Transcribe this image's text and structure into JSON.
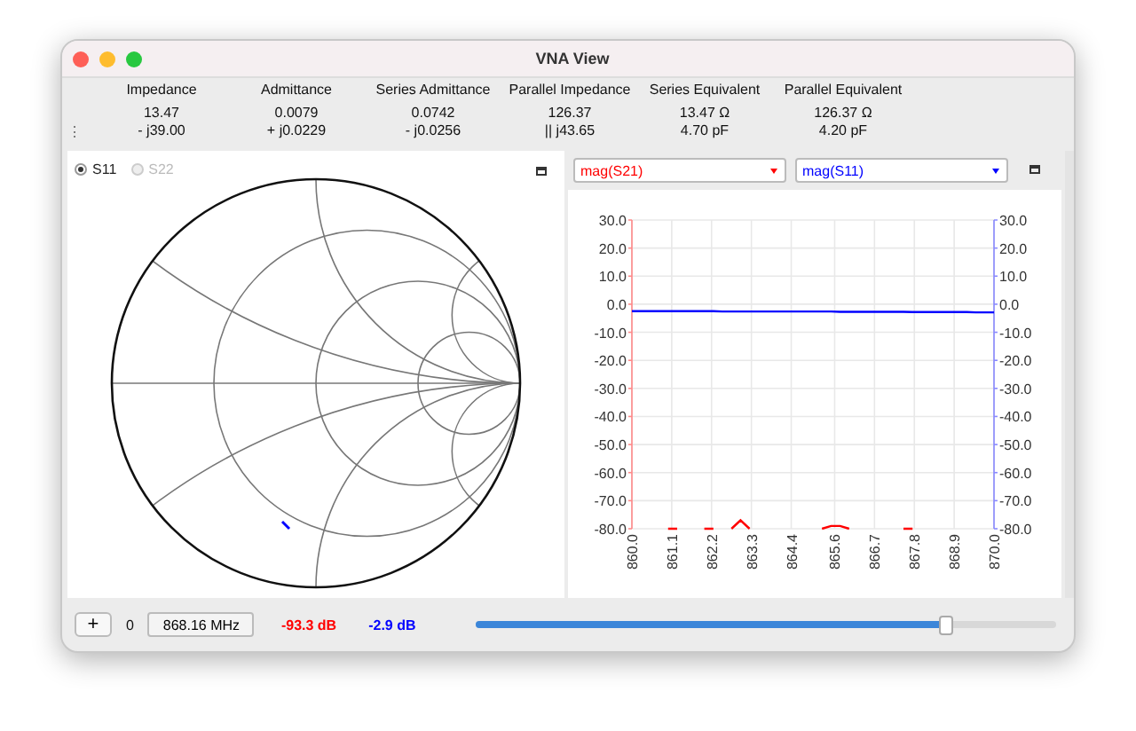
{
  "window": {
    "title": "VNA View"
  },
  "header": {
    "handle": "⋮",
    "measurements": [
      {
        "label": "Impedance",
        "line_1": "13.47",
        "line_2": "- j39.00"
      },
      {
        "label": "Admittance",
        "line_1": "0.0079",
        "line_2": "+ j0.0229"
      },
      {
        "label": "Series Admittance",
        "line_1": "0.0742",
        "line_2": "- j0.0256"
      },
      {
        "label": "Parallel Impedance",
        "line_1": "126.37",
        "line_2": "|| j43.65"
      },
      {
        "label": "Series Equivalent",
        "line_1": "13.47 Ω",
        "line_2": "4.70 pF"
      },
      {
        "label": "Parallel Equivalent",
        "line_1": "126.37 Ω",
        "line_2": "4.20 pF"
      }
    ]
  },
  "smith": {
    "ports": [
      {
        "label": "S11",
        "selected": true,
        "disabled": false
      },
      {
        "label": "S22",
        "selected": false,
        "disabled": true
      }
    ]
  },
  "plot": {
    "chart_data": {
      "type": "line",
      "grid": true,
      "x": [
        860,
        860.25,
        860.5,
        860.75,
        861,
        861.25,
        861.5,
        861.75,
        862,
        862.25,
        862.5,
        862.75,
        863,
        863.25,
        863.5,
        863.75,
        864,
        864.25,
        864.5,
        864.75,
        865,
        865.25,
        865.5,
        865.75,
        866,
        866.25,
        866.5,
        866.75,
        867,
        867.25,
        867.5,
        867.75,
        868,
        868.25,
        868.5,
        868.75,
        869,
        869.25,
        869.5,
        869.75,
        870
      ],
      "series": [
        {
          "name": "mag(S21)",
          "color": "#ff0000",
          "values": [
            null,
            null,
            null,
            null,
            -80,
            -80,
            null,
            null,
            -80,
            -80,
            null,
            -80,
            -77,
            -80,
            null,
            null,
            null,
            null,
            null,
            null,
            null,
            -80,
            -79,
            -79,
            -80,
            null,
            null,
            null,
            null,
            null,
            -80,
            -80,
            null,
            null,
            null,
            null,
            null,
            null,
            null,
            null,
            null
          ]
        },
        {
          "name": "mag(S11)",
          "color": "#0000ff",
          "values": [
            -2.5,
            -2.5,
            -2.5,
            -2.5,
            -2.5,
            -2.5,
            -2.5,
            -2.5,
            -2.5,
            -2.5,
            -2.6,
            -2.6,
            -2.6,
            -2.6,
            -2.6,
            -2.6,
            -2.6,
            -2.6,
            -2.6,
            -2.6,
            -2.6,
            -2.6,
            -2.6,
            -2.7,
            -2.7,
            -2.7,
            -2.7,
            -2.7,
            -2.7,
            -2.7,
            -2.7,
            -2.8,
            -2.8,
            -2.8,
            -2.8,
            -2.8,
            -2.8,
            -2.8,
            -2.9,
            -2.9,
            -2.9
          ]
        }
      ],
      "xlim": [
        860,
        870
      ],
      "ylim": [
        -80,
        30
      ],
      "xticks": [
        {
          "value": 860,
          "label": "860.0"
        },
        {
          "value": 861.1,
          "label": "861.1"
        },
        {
          "value": 862.2,
          "label": "862.2"
        },
        {
          "value": 863.3,
          "label": "863.3"
        },
        {
          "value": 864.4,
          "label": "864.4"
        },
        {
          "value": 865.6,
          "label": "865.6"
        },
        {
          "value": 866.7,
          "label": "866.7"
        },
        {
          "value": 867.8,
          "label": "867.8"
        },
        {
          "value": 868.9,
          "label": "868.9"
        },
        {
          "value": 870,
          "label": "870.0"
        }
      ],
      "yticks": [
        {
          "value": 30,
          "label": "30.0"
        },
        {
          "value": 20,
          "label": "20.0"
        },
        {
          "value": 10,
          "label": "10.0"
        },
        {
          "value": 0,
          "label": "0.0"
        },
        {
          "value": -10,
          "label": "-10.0"
        },
        {
          "value": -20,
          "label": "-20.0"
        },
        {
          "value": -30,
          "label": "-30.0"
        },
        {
          "value": -40,
          "label": "-40.0"
        },
        {
          "value": -50,
          "label": "-50.0"
        },
        {
          "value": -60,
          "label": "-60.0"
        },
        {
          "value": -70,
          "label": "-70.0"
        },
        {
          "value": -80,
          "label": "-80.0"
        }
      ]
    }
  },
  "bottom_bar": {
    "add_button": "+",
    "index": "0",
    "frequency": "868.16 MHz",
    "readings": [
      {
        "text": "-93.3 dB",
        "color": "#ff0000"
      },
      {
        "text": "-2.9 dB",
        "color": "#0000ff"
      }
    ],
    "slider": {
      "level": 0.81
    }
  }
}
